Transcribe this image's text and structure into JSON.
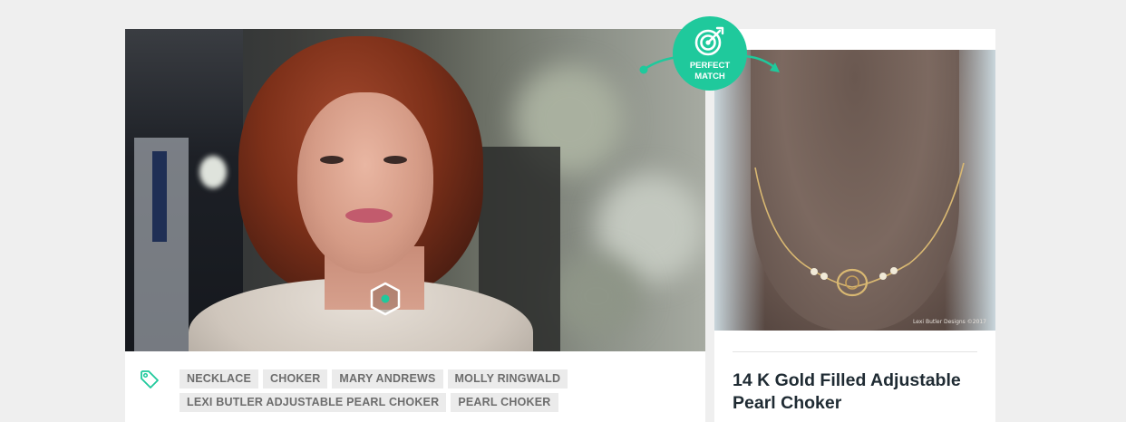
{
  "badge": {
    "line1": "PERFECT",
    "line2": "MATCH",
    "icon": "target-icon"
  },
  "tags": [
    "NECKLACE",
    "CHOKER",
    "MARY ANDREWS",
    "MOLLY RINGWALD",
    "LEXI BUTLER ADJUSTABLE PEARL CHOKER",
    "PEARL CHOKER"
  ],
  "product": {
    "title": "14 K Gold Filled Adjustable Pearl Choker",
    "image_credit": "Lexi Butler Designs ©2017"
  },
  "colors": {
    "accent": "#1fc99c",
    "tag_bg": "#ebebeb",
    "tag_text": "#6d6d6d",
    "title": "#1f2b33"
  }
}
